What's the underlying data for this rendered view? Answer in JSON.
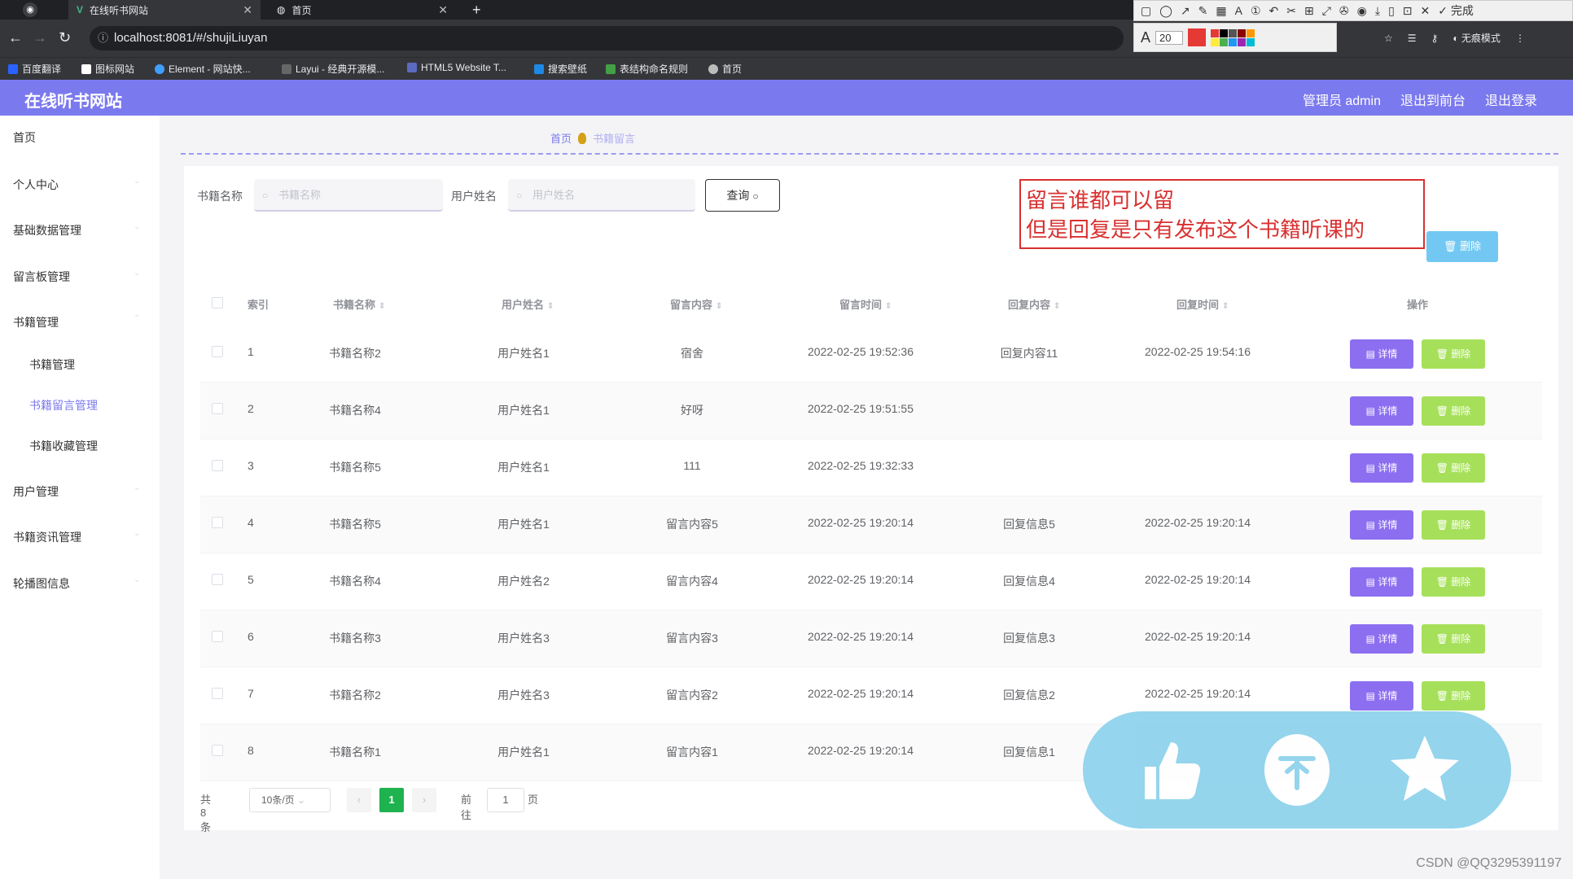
{
  "browser": {
    "tabs": [
      {
        "title": "在线听书网站",
        "active": true
      },
      {
        "title": "首页",
        "active": false
      }
    ],
    "url": "localhost:8081/#/shujiLiuyan",
    "bookmarks": [
      "百度翻译",
      "图标网站",
      "Element - 网站快...",
      "Layui - 经典开源模...",
      "HTML5 Website T...",
      "搜索壁纸",
      "表结构命名规则",
      "首页"
    ],
    "annotation_font_size": "20",
    "annotation_done": "完成",
    "mode_label": "无痕模式",
    "swatch_colors": [
      "#e53935",
      "#000000",
      "#555555",
      "#8b0000",
      "#ff9800",
      "#ffeb3b",
      "#4caf50",
      "#2196f3",
      "#9c27b0",
      "#00bcd4"
    ]
  },
  "header": {
    "title": "在线听书网站",
    "links": [
      "管理员 admin",
      "退出到前台",
      "退出登录"
    ]
  },
  "sidebar": {
    "items": [
      {
        "label": "首页"
      },
      {
        "label": "个人中心"
      },
      {
        "label": "基础数据管理"
      },
      {
        "label": "留言板管理"
      },
      {
        "label": "书籍管理"
      },
      {
        "label": "用户管理"
      },
      {
        "label": "书籍资讯管理"
      },
      {
        "label": "轮播图信息"
      }
    ],
    "sub_items": [
      {
        "label": "书籍管理",
        "active": false
      },
      {
        "label": "书籍留言管理",
        "active": true
      },
      {
        "label": "书籍收藏管理",
        "active": false
      }
    ]
  },
  "breadcrumb": {
    "home": "首页",
    "current": "书籍留言"
  },
  "search": {
    "book_label": "书籍名称",
    "book_placeholder": "书籍名称",
    "user_label": "用户姓名",
    "user_placeholder": "用户姓名",
    "query_label": "查询"
  },
  "annotation_note": {
    "line1": "留言谁都可以留",
    "line2": "但是回复是只有发布这个书籍听课的"
  },
  "toolbar": {
    "delete_label": "删除"
  },
  "table": {
    "headers": [
      "索引",
      "书籍名称",
      "用户姓名",
      "留言内容",
      "留言时间",
      "回复内容",
      "回复时间",
      "操作"
    ],
    "rows": [
      {
        "idx": "1",
        "book": "书籍名称2",
        "user": "用户姓名1",
        "content": "宿舍",
        "time": "2022-02-25 19:52:36",
        "reply": "回复内容11",
        "reply_time": "2022-02-25 19:54:16"
      },
      {
        "idx": "2",
        "book": "书籍名称4",
        "user": "用户姓名1",
        "content": "好呀",
        "time": "2022-02-25 19:51:55",
        "reply": "",
        "reply_time": ""
      },
      {
        "idx": "3",
        "book": "书籍名称5",
        "user": "用户姓名1",
        "content": "111",
        "time": "2022-02-25 19:32:33",
        "reply": "",
        "reply_time": ""
      },
      {
        "idx": "4",
        "book": "书籍名称5",
        "user": "用户姓名1",
        "content": "留言内容5",
        "time": "2022-02-25 19:20:14",
        "reply": "回复信息5",
        "reply_time": "2022-02-25 19:20:14"
      },
      {
        "idx": "5",
        "book": "书籍名称4",
        "user": "用户姓名2",
        "content": "留言内容4",
        "time": "2022-02-25 19:20:14",
        "reply": "回复信息4",
        "reply_time": "2022-02-25 19:20:14"
      },
      {
        "idx": "6",
        "book": "书籍名称3",
        "user": "用户姓名3",
        "content": "留言内容3",
        "time": "2022-02-25 19:20:14",
        "reply": "回复信息3",
        "reply_time": "2022-02-25 19:20:14"
      },
      {
        "idx": "7",
        "book": "书籍名称2",
        "user": "用户姓名3",
        "content": "留言内容2",
        "time": "2022-02-25 19:20:14",
        "reply": "回复信息2",
        "reply_time": "2022-02-25 19:20:14"
      },
      {
        "idx": "8",
        "book": "书籍名称1",
        "user": "用户姓名1",
        "content": "留言内容1",
        "time": "2022-02-25 19:20:14",
        "reply": "回复信息1",
        "reply_time": ""
      }
    ],
    "detail_label": "详情",
    "delete_label": "删除"
  },
  "pagination": {
    "total": "共 8 条",
    "page_size": "10条/页",
    "current": "1",
    "goto_prefix": "前往",
    "goto_value": "1",
    "goto_suffix": "页"
  },
  "watermark": "CSDN @QQ3295391197"
}
